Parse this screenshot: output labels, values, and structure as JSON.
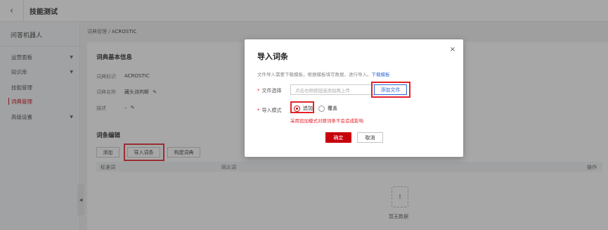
{
  "topbar": {
    "back_icon": "chevron-left",
    "title": "技能测试"
  },
  "sidebar": {
    "title": "问答机器人",
    "items": [
      {
        "label": "运营面板",
        "has_caret": true
      },
      {
        "label": "知识库",
        "has_caret": true
      },
      {
        "label": "技能管理",
        "has_caret": false
      },
      {
        "label": "词典管理",
        "has_caret": false,
        "active": true
      },
      {
        "label": "高级设置",
        "has_caret": true
      }
    ],
    "collapse_icon": "chevron-left"
  },
  "breadcrumb": {
    "parent": "词典管理",
    "separator": "/",
    "current": "ACROSTIC"
  },
  "basic_info": {
    "heading": "词典基本信息",
    "id_label": "词典标识",
    "id_value": "ACROSTIC",
    "name_label": "词典名称",
    "name_value": "藏头诗判断",
    "desc_label": "描述",
    "desc_value": "–"
  },
  "entry_edit": {
    "heading": "词条编辑",
    "add_label": "添加",
    "import_label": "导入词条",
    "build_label": "构建词典"
  },
  "table": {
    "columns": [
      "标准词",
      "同义词",
      "操作"
    ],
    "empty_text": "暂无数据",
    "empty_icon": "!"
  },
  "modal": {
    "title": "导入词条",
    "close_icon": "×",
    "tip_text": "文件导入需要下载模板，根据模板填写数据，进行导入。",
    "tip_link": "下载模板",
    "file_label": "文件选择",
    "file_placeholder": "点击右侧按钮选添加再上传",
    "file_button": "添加文件",
    "mode_label": "导入模式",
    "mode_options": [
      "追加",
      "覆盖"
    ],
    "mode_selected": "追加",
    "mode_hint": "采用追加模式对原词条不会造成影响",
    "ok_label": "确定",
    "cancel_label": "取消"
  },
  "colors": {
    "accent": "#c7000b",
    "link": "#2d6ad6",
    "highlight": "#e4232a"
  }
}
